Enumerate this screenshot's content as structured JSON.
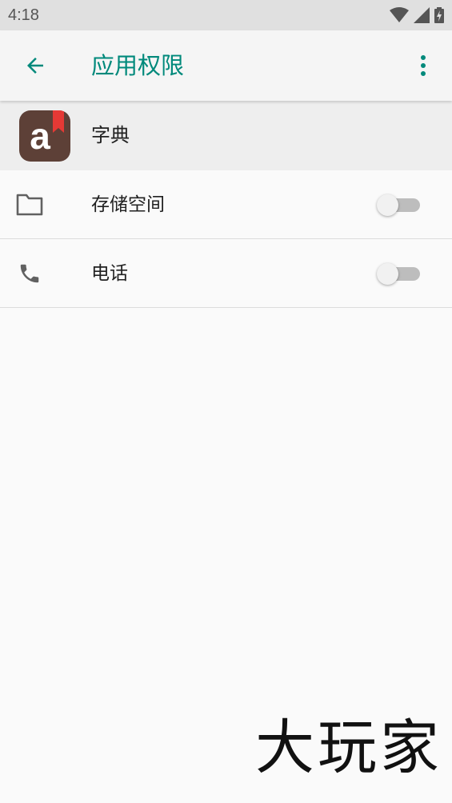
{
  "status_bar": {
    "time": "4:18",
    "icons": [
      "wifi-icon",
      "signal-icon",
      "battery-charging-icon"
    ]
  },
  "app_bar": {
    "title": "应用权限",
    "back_icon": "arrow-left-icon",
    "more_icon": "more-vert-icon",
    "accent_color": "#00897b"
  },
  "app": {
    "name": "字典",
    "icon_letter": "a",
    "icon_color": "#5d4037",
    "ribbon_color": "#e53935"
  },
  "permissions": [
    {
      "label": "存储空间",
      "icon": "folder-icon",
      "enabled": false
    },
    {
      "label": "电话",
      "icon": "phone-icon",
      "enabled": false
    }
  ],
  "watermark": "大玩家"
}
